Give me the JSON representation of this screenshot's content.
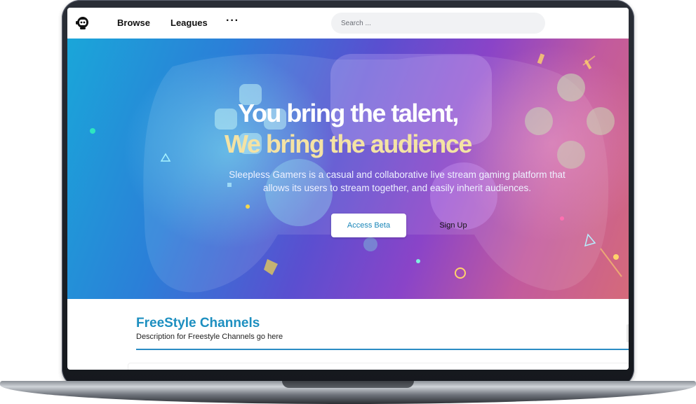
{
  "nav": {
    "links": [
      "Browse",
      "Leagues"
    ],
    "more_icon": "···",
    "search_placeholder": "Search ..."
  },
  "hero": {
    "title_line1": "You bring the talent,",
    "title_line2": "We bring the audience",
    "description": "Sleepless Gamers is a casual and collaborative live stream gaming platform that allows its users to stream together, and easily inherit audiences.",
    "primary_button": "Access Beta",
    "secondary_button": "Sign Up"
  },
  "channels": {
    "title": "FreeStyle Channels",
    "description": "Description for Freestyle Channels go here"
  },
  "colors": {
    "accent": "#1d8fc0",
    "title_highlight": "#f4e3a4",
    "nav_search_bg": "#f1f2f4"
  },
  "icons": {
    "logo": "robot-logo-icon",
    "more": "more-dots-icon"
  }
}
